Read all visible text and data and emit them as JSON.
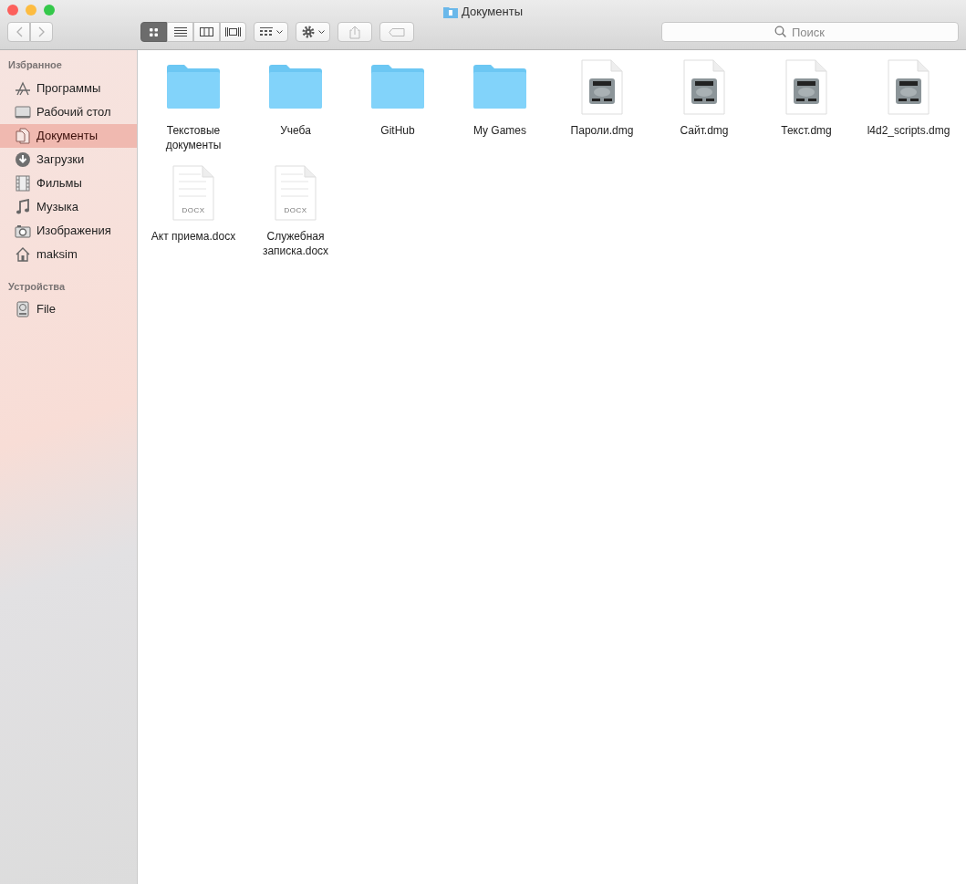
{
  "window": {
    "title": "Документы"
  },
  "toolbar": {
    "view_modes": [
      {
        "kind": "icons",
        "selected": true
      },
      {
        "kind": "list",
        "selected": false
      },
      {
        "kind": "columns",
        "selected": false
      },
      {
        "kind": "coverflow",
        "selected": false
      }
    ]
  },
  "search": {
    "placeholder": "Поиск"
  },
  "sidebar": {
    "sections": [
      {
        "title": "Избранное",
        "items": [
          {
            "label": "Программы",
            "kind": "apps",
            "selected": false
          },
          {
            "label": "Рабочий стол",
            "kind": "desktop",
            "selected": false
          },
          {
            "label": "Документы",
            "kind": "documents",
            "selected": true
          },
          {
            "label": "Загрузки",
            "kind": "downloads",
            "selected": false
          },
          {
            "label": "Фильмы",
            "kind": "movies",
            "selected": false
          },
          {
            "label": "Музыка",
            "kind": "music",
            "selected": false
          },
          {
            "label": "Изображения",
            "kind": "pictures",
            "selected": false
          },
          {
            "label": "maksim",
            "kind": "home",
            "selected": false
          }
        ]
      },
      {
        "title": "Устройства",
        "items": [
          {
            "label": "File",
            "kind": "disk",
            "selected": false
          }
        ]
      }
    ]
  },
  "files": [
    {
      "name": "Текстовые документы",
      "kind": "folder"
    },
    {
      "name": "Учеба",
      "kind": "folder"
    },
    {
      "name": "GitHub",
      "kind": "folder"
    },
    {
      "name": "My Games",
      "kind": "folder"
    },
    {
      "name": "Пароли.dmg",
      "kind": "dmg"
    },
    {
      "name": "Сайт.dmg",
      "kind": "dmg"
    },
    {
      "name": "Текст.dmg",
      "kind": "dmg"
    },
    {
      "name": "l4d2_scripts.dmg",
      "kind": "dmg"
    },
    {
      "name": "Акт приема.docx",
      "kind": "docx",
      "badge": "DOCX"
    },
    {
      "name": "Служебная записка.docx",
      "kind": "docx",
      "badge": "DOCX"
    }
  ]
}
